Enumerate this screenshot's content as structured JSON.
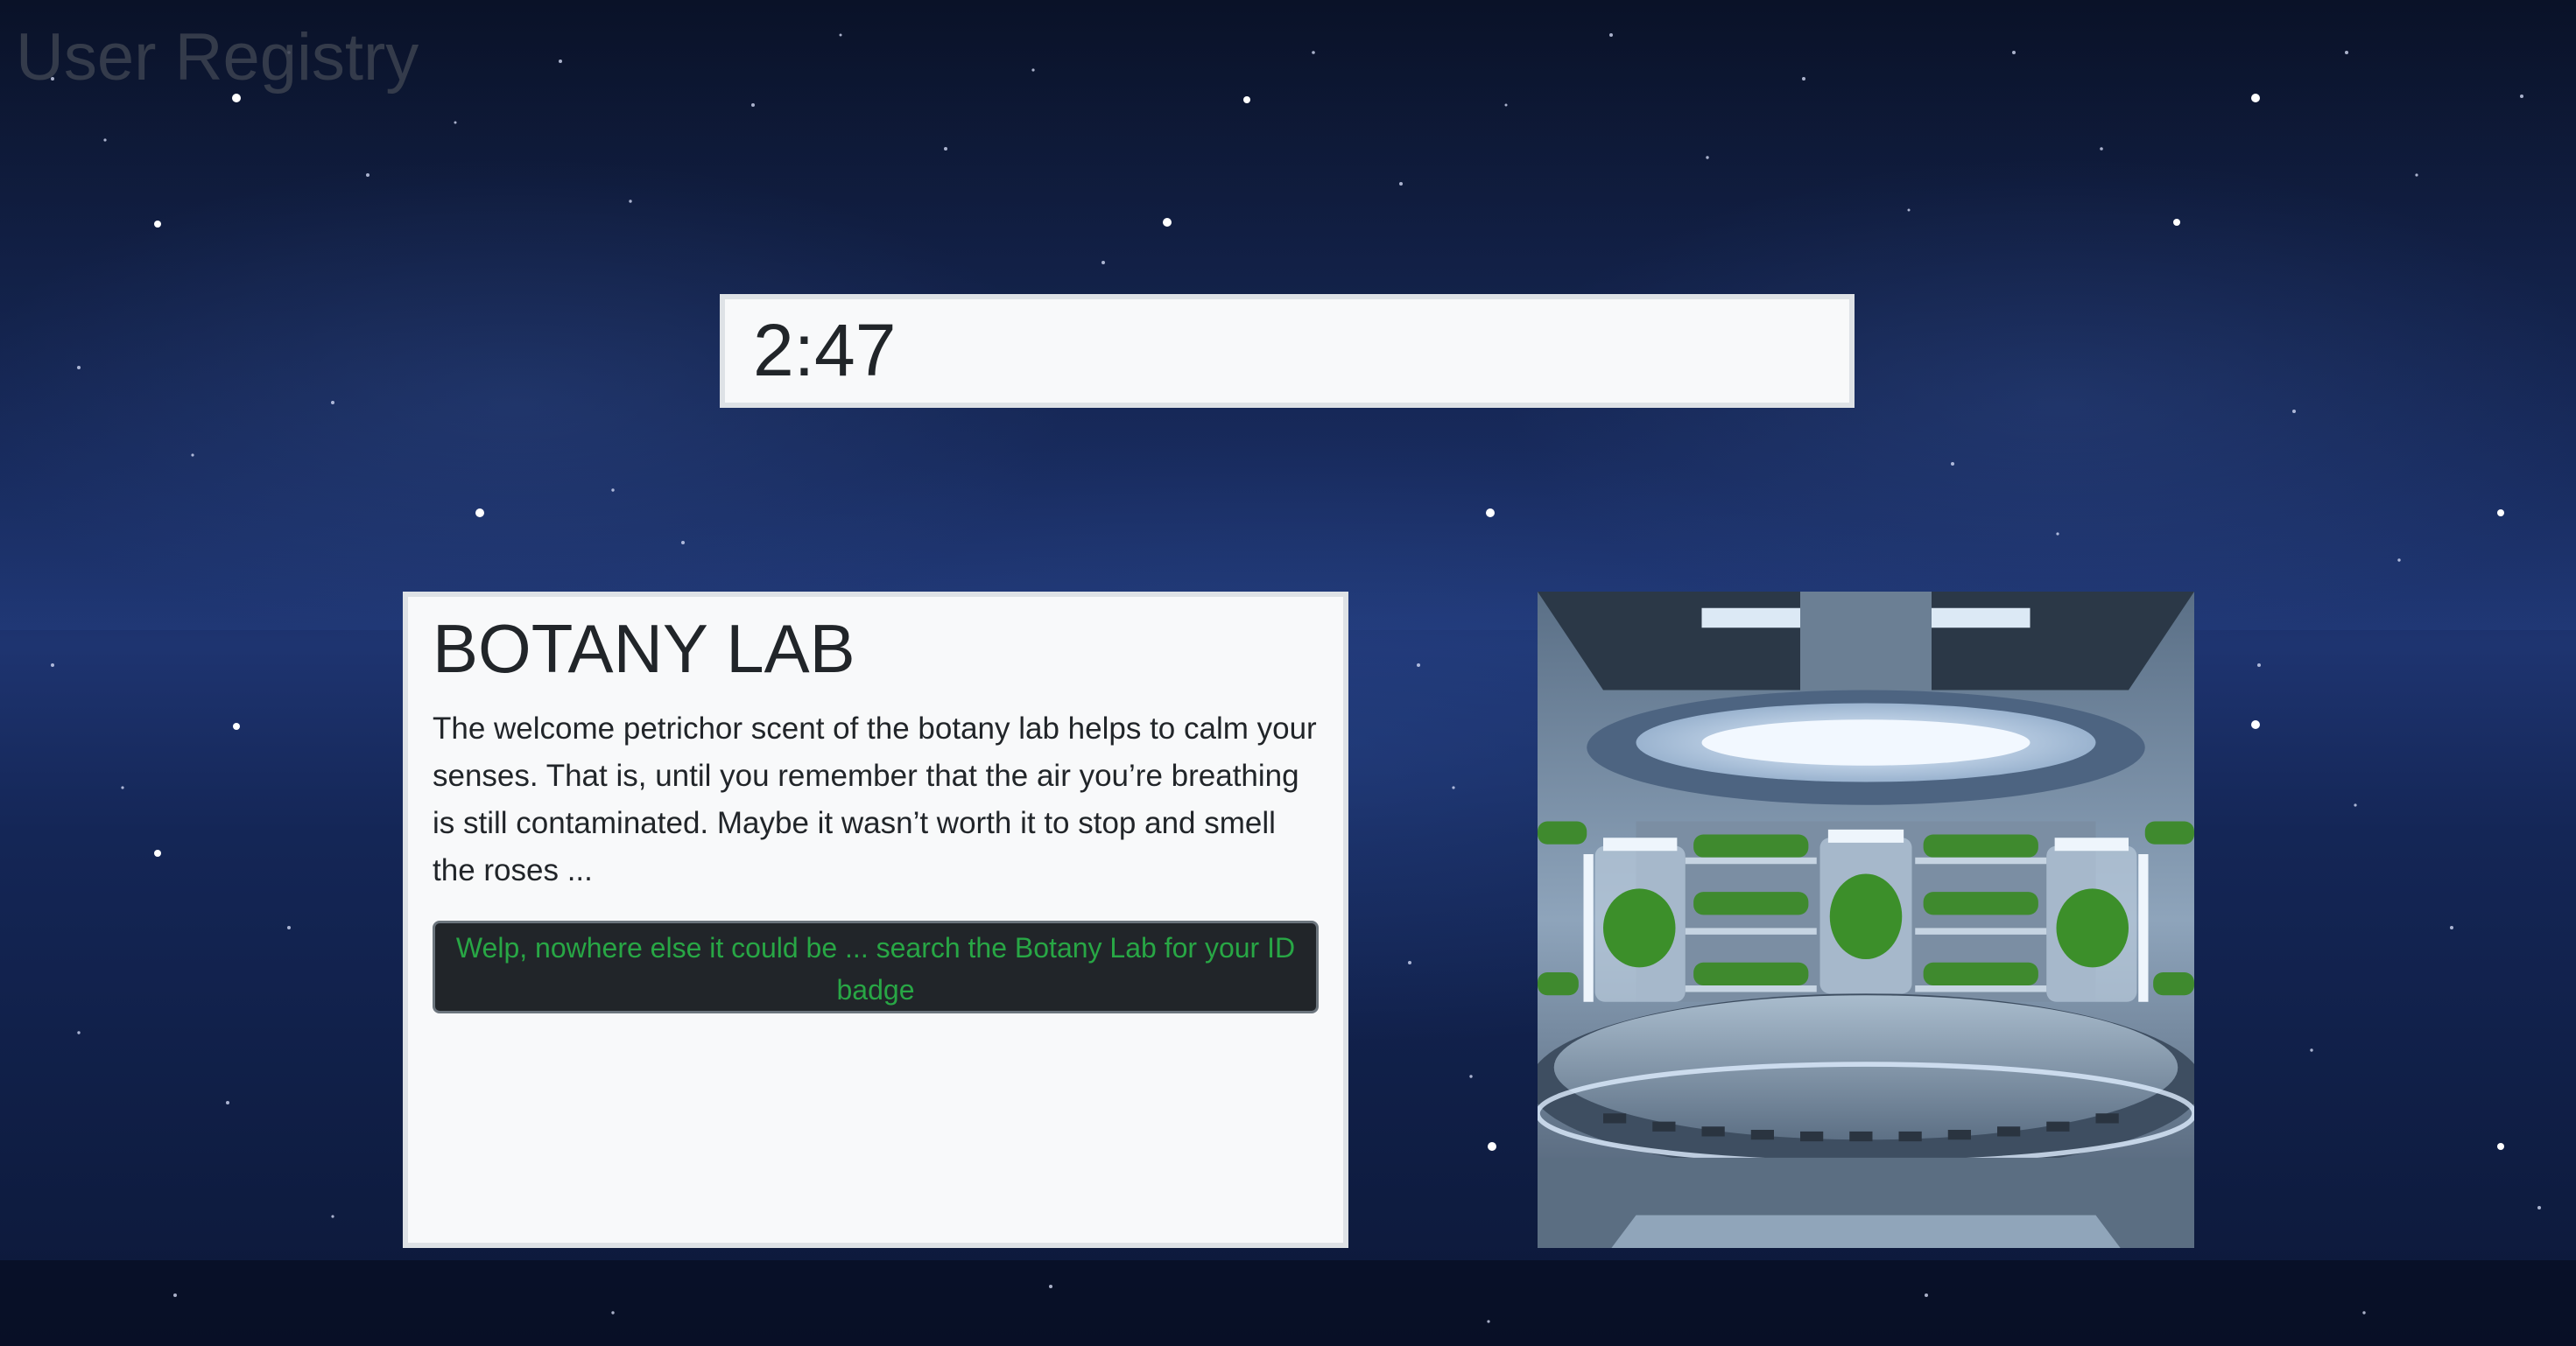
{
  "header": {
    "site_title": "User Registry"
  },
  "timer": {
    "time_remaining": "2:47"
  },
  "room": {
    "title": "BOTANY LAB",
    "description": "The welcome petrichor scent of the botany lab helps to calm your senses. That is, until you remember that the air you’re breathing is still contaminated. Maybe it wasn’t worth it to stop and smell the roses ...",
    "action_label": "Welp, nowhere else it could be ... search the Botany Lab for your ID badge",
    "image_icon": "botany-lab-image"
  },
  "colors": {
    "panel_bg": "#f8f9fa",
    "panel_border": "#dee2e6",
    "button_bg": "#212529",
    "button_text": "#28a745",
    "title_text": "#212529"
  }
}
